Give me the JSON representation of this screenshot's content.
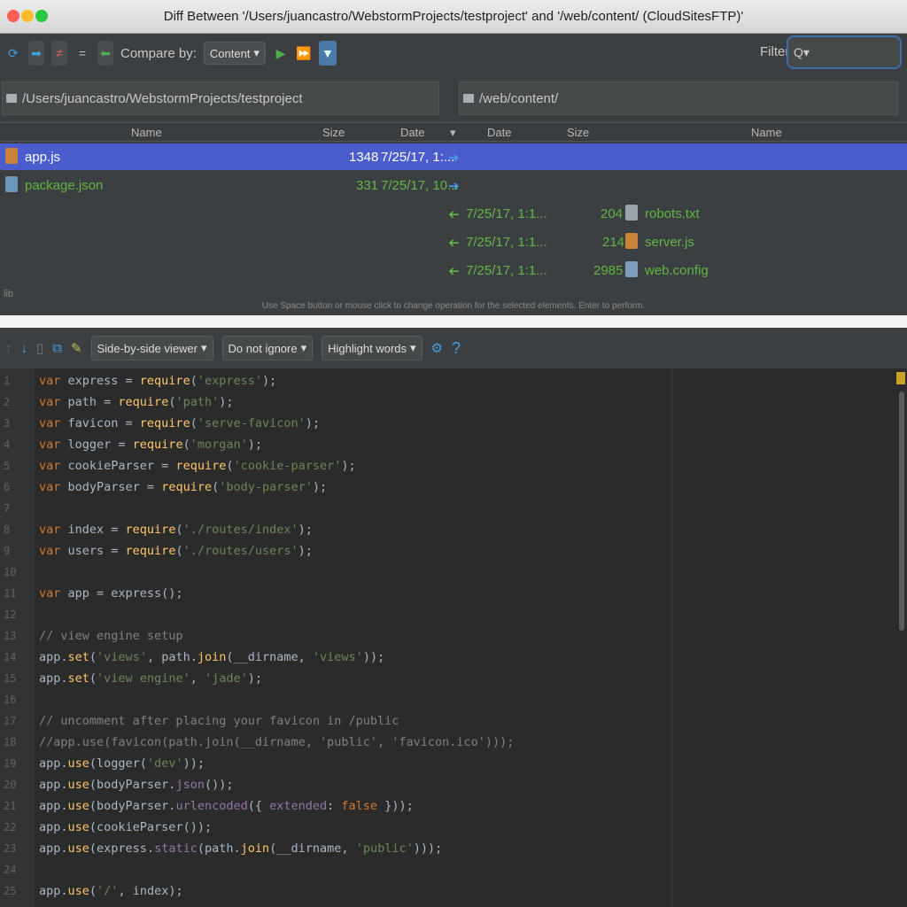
{
  "window": {
    "title": "Diff Between '/Users/juancastro/WebstormProjects/testproject' and '/web/content/ (CloudSitesFTP)'"
  },
  "toolbar": {
    "compare_label": "Compare by:",
    "compare_value": "Content",
    "filter_label": "Filter:",
    "filter_value": "Q▾"
  },
  "paths": {
    "left": "/Users/juancastro/WebstormProjects/testproject",
    "right": "/web/content/"
  },
  "columns": {
    "left_name": "Name",
    "left_size": "Size",
    "left_date": "Date",
    "mid": "▾",
    "right_date": "Date",
    "right_size": "Size",
    "right_name": "Name"
  },
  "files": [
    {
      "left_name": "app.js",
      "left_size": "1348",
      "left_date": "7/25/17, 1:...",
      "arrow": "➔",
      "right_date": "",
      "right_size": "",
      "right_name": ""
    },
    {
      "left_name": "package.json",
      "left_size": "331",
      "left_date": "7/25/17, 10...",
      "arrow": "➔",
      "right_date": "",
      "right_size": "",
      "right_name": ""
    },
    {
      "left_name": "",
      "left_size": "",
      "left_date": "",
      "arrow": "➔",
      "right_date": "7/25/17, 1:1...",
      "right_size": "204",
      "right_name": "robots.txt"
    },
    {
      "left_name": "",
      "left_size": "",
      "left_date": "",
      "arrow": "➔",
      "right_date": "7/25/17, 1:1...",
      "right_size": "214",
      "right_name": "server.js"
    },
    {
      "left_name": "",
      "left_size": "",
      "left_date": "",
      "arrow": "➔",
      "right_date": "7/25/17, 1:1...",
      "right_size": "2985",
      "right_name": "web.config"
    }
  ],
  "hint": "Use Space button or mouse click to change operation for the selected elements. Enter to perform.",
  "libraries": "lib",
  "diff_toolbar": {
    "viewer": "Side-by-side viewer",
    "ignore": "Do not ignore",
    "highlight": "Highlight words",
    "help": "?"
  },
  "colors": {
    "accent": "#4b5dcc",
    "keyword": "#cc7832",
    "function": "#ffc66d",
    "string": "#6a8759",
    "comment": "#808080",
    "added": "#62b543"
  }
}
